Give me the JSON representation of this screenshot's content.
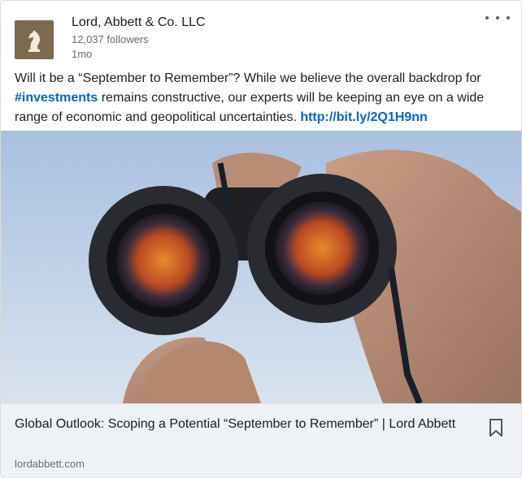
{
  "post": {
    "company": "Lord, Abbett & Co. LLC",
    "followers": "12,037 followers",
    "time": "1mo",
    "text_before": "Will it be a “September to Remember”? While we believe the overall backdrop for ",
    "hashtag": "#investments",
    "text_middle": " remains constructive, our experts will be keeping an eye on a wide range of economic and geopolitical uncertainties. ",
    "link": "http://bit.ly/2Q1H9nn"
  },
  "preview": {
    "title": "Global Outlook: Scoping a Potential “September to Remember” | Lord Abbett",
    "domain": "lordabbett.com"
  },
  "colors": {
    "link": "#0a66c2",
    "logo_bg": "#7b6a4f",
    "sky": "#bfd0e4"
  },
  "icons": {
    "menu": "more-options-icon",
    "bookmark": "bookmark-icon",
    "logo": "chess-knight-logo"
  }
}
